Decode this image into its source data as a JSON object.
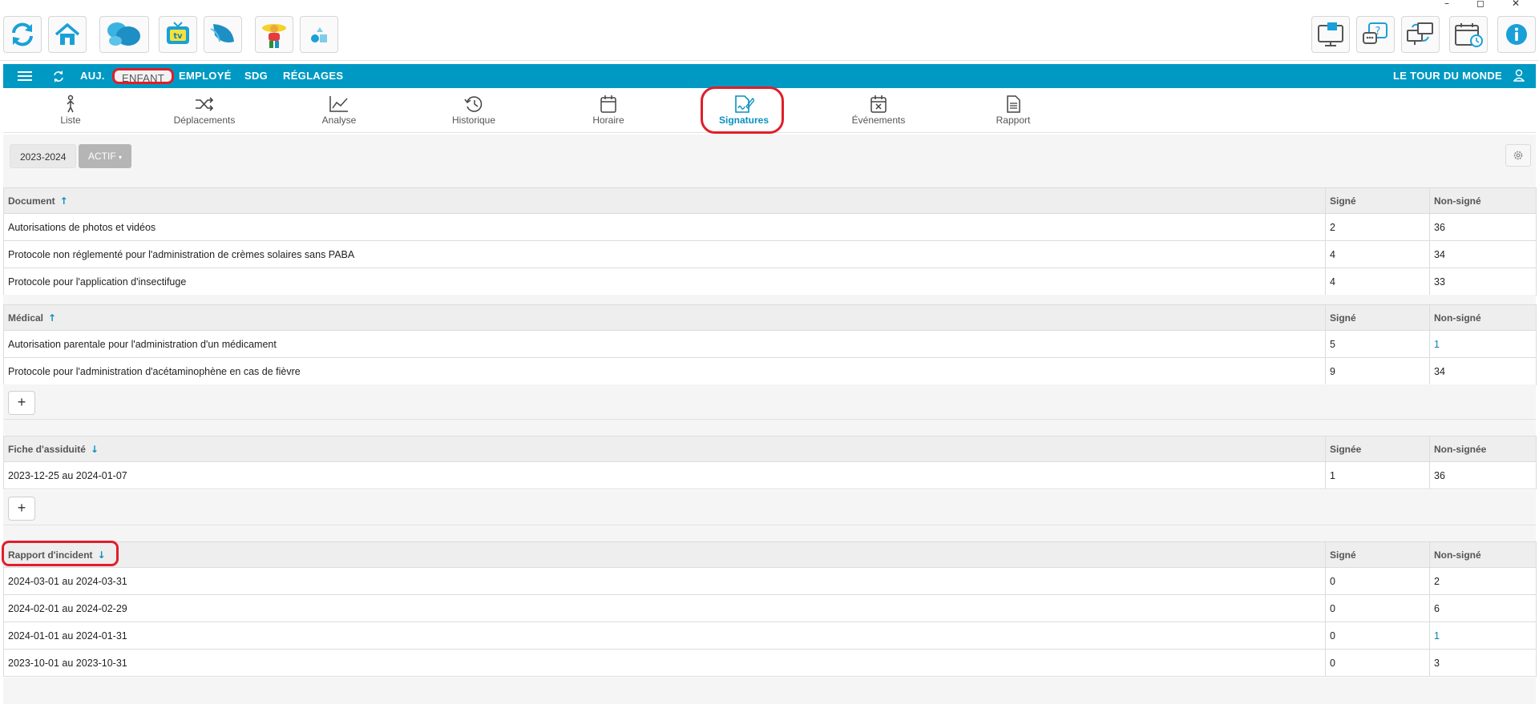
{
  "window": {
    "minimize": "–",
    "maximize": "◻",
    "close": "✕"
  },
  "appbar": {
    "left_icons": [
      "refresh-icon",
      "home-icon",
      "butterfly-icon",
      "tv-icon",
      "wing-icon",
      "kid-icon",
      "shapes-icon"
    ],
    "right_icons": [
      "monitor-message-icon",
      "chat-question-icon",
      "screen-sync-icon",
      "calendar-clock-icon",
      "info-icon"
    ],
    "tv_label": "tv"
  },
  "nav": {
    "items": [
      "AUJ.",
      "ENFANT",
      "EMPLOYÉ",
      "SDG",
      "RÉGLAGES"
    ],
    "location": "LE TOUR DU MONDE"
  },
  "tabs": [
    {
      "label": "Liste"
    },
    {
      "label": "Déplacements"
    },
    {
      "label": "Analyse"
    },
    {
      "label": "Historique"
    },
    {
      "label": "Horaire"
    },
    {
      "label": "Signatures"
    },
    {
      "label": "Événements"
    },
    {
      "label": "Rapport"
    }
  ],
  "active_tab": "Signatures",
  "filters": {
    "year": "2023-2024",
    "status": "ACTIF"
  },
  "sort_icons": {
    "up": "↑",
    "down": "↓"
  },
  "add_label": "+",
  "sections": {
    "document": {
      "header": [
        "Document",
        "Signé",
        "Non-signé"
      ],
      "rows": [
        [
          "Autorisations de photos et vidéos",
          "2",
          "36"
        ],
        [
          "Protocole non réglementé pour l'administration de crèmes solaires sans PABA",
          "4",
          "34"
        ],
        [
          "Protocole pour l'application d'insectifuge",
          "4",
          "33"
        ]
      ]
    },
    "medical": {
      "header": [
        "Médical",
        "Signé",
        "Non-signé"
      ],
      "rows": [
        [
          "Autorisation parentale pour l'administration d'un médicament",
          "5",
          "1"
        ],
        [
          "Protocole pour l'administration d'acétaminophène en cas de fièvre",
          "9",
          "34"
        ]
      ]
    },
    "assiduite": {
      "header": [
        "Fiche d'assiduité",
        "Signée",
        "Non-signée"
      ],
      "rows": [
        [
          "2023-12-25 au 2024-01-07",
          "1",
          "36"
        ]
      ]
    },
    "incident": {
      "header": [
        "Rapport d'incident",
        "Signé",
        "Non-signé"
      ],
      "rows": [
        [
          "2024-03-01 au 2024-03-31",
          "0",
          "2"
        ],
        [
          "2024-02-01 au 2024-02-29",
          "0",
          "6"
        ],
        [
          "2024-01-01 au 2024-01-31",
          "0",
          "1"
        ],
        [
          "2023-10-01 au 2023-10-31",
          "0",
          "3"
        ]
      ]
    }
  },
  "colors": {
    "primary": "#0099c4",
    "highlight": "#e01e2a",
    "link": "#0a7fae"
  }
}
